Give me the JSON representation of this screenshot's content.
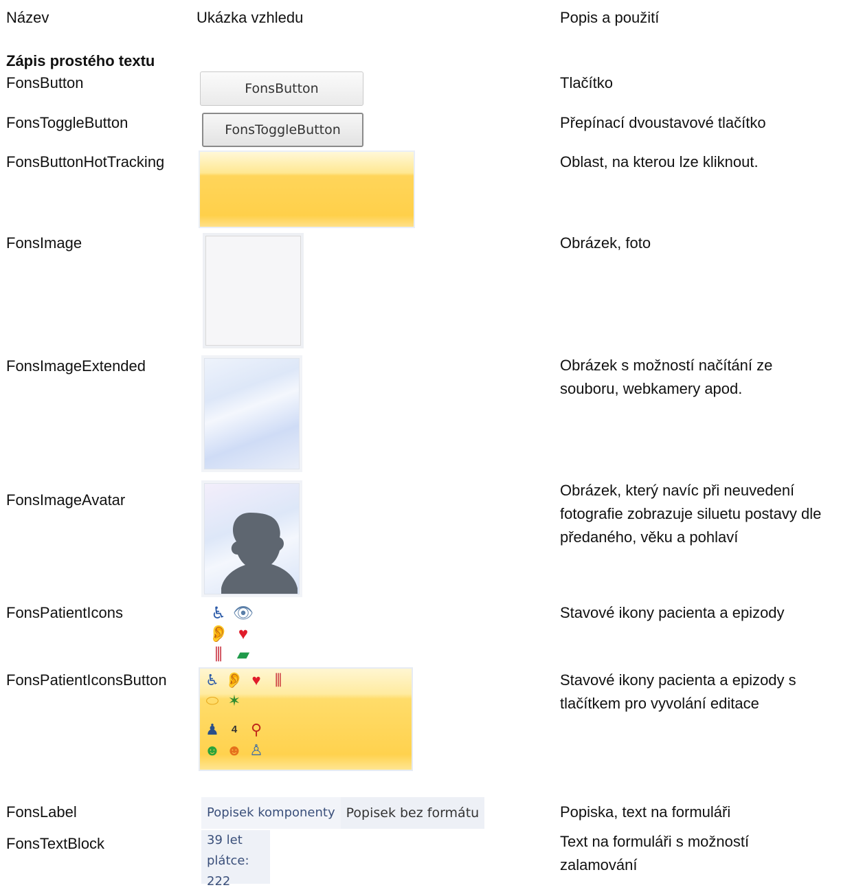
{
  "headers": {
    "name": "Název",
    "preview": "Ukázka vzhledu",
    "description": "Popis a použití"
  },
  "section_title": "Zápis prostého textu",
  "rows": [
    {
      "name": "FonsButton",
      "description": "Tlačítko",
      "sample": "FonsButton"
    },
    {
      "name": "FonsToggleButton",
      "description": "Přepínací dvoustavové tlačítko",
      "sample": "FonsToggleButton"
    },
    {
      "name": "FonsButtonHotTracking",
      "description": "Oblast, na kterou lze kliknout."
    },
    {
      "name": "FonsImage",
      "description": "Obrázek, foto"
    },
    {
      "name": "FonsImageExtended",
      "description": "Obrázek s možností načítání ze souboru, webkamery apod."
    },
    {
      "name": "FonsImageAvatar",
      "description": "Obrázek, který navíc při neuvedení fotografie zobrazuje siluetu postavy dle předaného, věku a pohlaví"
    },
    {
      "name": "FonsPatientIcons",
      "description": "Stavové ikony pacienta a epizody"
    },
    {
      "name": "FonsPatientIconsButton",
      "description": "Stavové ikony pacienta a epizody s tlačítkem pro vyvolání editace"
    },
    {
      "name": "FonsLabel",
      "description": "Popiska, text na formuláři"
    },
    {
      "name": "FonsTextBlock",
      "description": "Text na formuláři s možností zalamování"
    }
  ],
  "label_samples": {
    "formatted": "Popisek komponenty",
    "plain": "Popisek bez formátu"
  },
  "textblock_lines": [
    "39 let",
    "plátce: 222"
  ],
  "patient_icons": [
    "wheelchair-icon",
    "eye-icon",
    "ear-icon",
    "heart-icon",
    "test-tubes-icon",
    "banknote-icon"
  ],
  "patient_icons_button": [
    "wheelchair-icon",
    "ear-icon",
    "heart-icon",
    "test-tubes-icon",
    "pills-icon",
    "leaf-icon",
    "person-icon",
    "number-badge-icon",
    "fire-extinguisher-icon",
    "smile-green-icon",
    "smile-orange-icon",
    "person-small-icon"
  ],
  "patient_icons_button_badge": "4"
}
